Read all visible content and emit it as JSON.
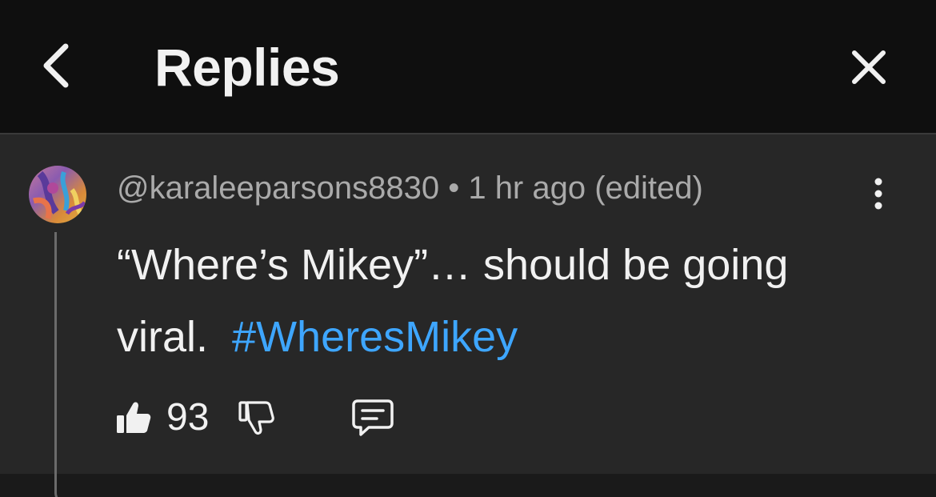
{
  "header": {
    "title": "Replies",
    "back_icon": "chevron-left-icon",
    "close_icon": "close-icon"
  },
  "comment": {
    "username": "@karaleeparsons8830",
    "separator": " • ",
    "timestamp": "1 hr ago (edited)",
    "text": "“Where’s Mikey”… should be going viral.  ",
    "hashtag": "#WheresMikey",
    "like_count": "93",
    "icons": {
      "like": "thumbs-up-filled-icon",
      "dislike": "thumbs-down-icon",
      "reply": "comment-reply-icon",
      "menu": "more-vertical-icon"
    }
  },
  "colors": {
    "background": "#0f0f0f",
    "panel": "#272727",
    "text": "#f1f1f1",
    "muted": "#aaaaaa",
    "hashtag": "#3ea6ff"
  }
}
